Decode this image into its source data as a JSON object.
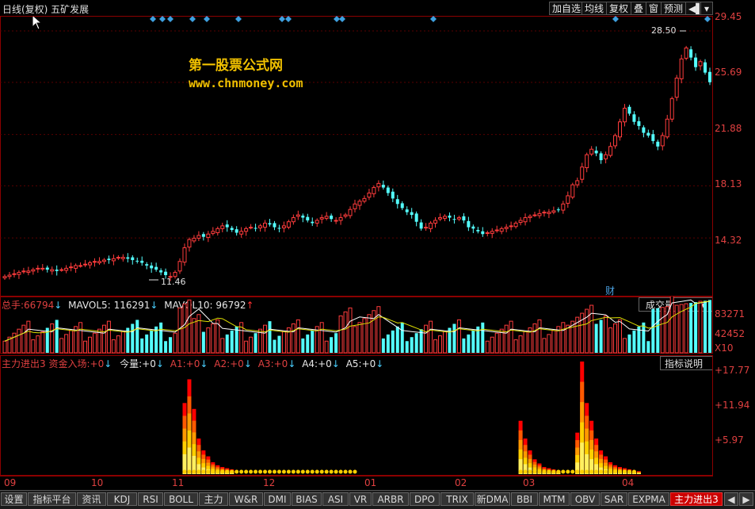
{
  "title": "日线(复权) 五矿发展",
  "toolbar": {
    "add_watch": "加自选",
    "ma_line": "均线",
    "restore": "复权",
    "overlay": "叠",
    "window": "窗",
    "forecast": "预测"
  },
  "watermark": {
    "line1": "第一股票公式网",
    "line2": "www.chnmoney.com"
  },
  "price_panel": {
    "y_ticks": [
      "29.45",
      "25.69",
      "21.88",
      "18.13",
      "14.32"
    ],
    "high_label": "28.50",
    "low_label": "11.46",
    "finance_marker": "财"
  },
  "volume_panel": {
    "legend": {
      "total_label": "总手:",
      "total_value": "66794",
      "mavol5_label": "MAVOL5:",
      "mavol5_value": "116291",
      "mavol10_label": "MAVOL10:",
      "mavol10_value": "96792"
    },
    "selector": "成交量",
    "y_ticks": [
      "83271",
      "42452"
    ],
    "unit": "X10"
  },
  "indicator_panel": {
    "legend": {
      "name": "主力进出3",
      "item1_label": "资金入场:",
      "item1_value": "+0",
      "item2_label": "今量:",
      "item2_value": "+0",
      "a1_label": "A1:",
      "a1_value": "+0",
      "a2_label": "A2:",
      "a2_value": "+0",
      "a3_label": "A3:",
      "a3_value": "+0",
      "a4_label": "A4:",
      "a4_value": "+0",
      "a5_label": "A5:",
      "a5_value": "+0"
    },
    "help_button": "指标说明",
    "y_ticks": [
      "+17.77",
      "+11.94",
      "+5.97"
    ]
  },
  "date_axis": [
    "09",
    "10",
    "11",
    "12",
    "01",
    "02",
    "03",
    "04"
  ],
  "tabs": [
    "设置",
    "指标平台",
    "资讯",
    "KDJ",
    "RSI",
    "BOLL",
    "主力",
    "W&R",
    "DMI",
    "BIAS",
    "ASI",
    "VR",
    "ARBR",
    "DPO",
    "TRIX",
    "新DMA",
    "BBI",
    "MTM",
    "OBV",
    "SAR",
    "EXPMA",
    "主力进出3"
  ],
  "chart_data": {
    "type": "candlestick",
    "price_range": [
      10.5,
      30.2
    ],
    "close_series": [
      11.5,
      11.6,
      11.7,
      11.8,
      11.9,
      11.9,
      12.0,
      12.1,
      12.1,
      12.0,
      12.0,
      11.9,
      12.0,
      12.1,
      12.2,
      12.3,
      12.3,
      12.4,
      12.5,
      12.6,
      12.6,
      12.7,
      12.7,
      12.8,
      12.9,
      12.9,
      12.8,
      12.7,
      12.6,
      12.5,
      12.3,
      12.1,
      12.0,
      11.8,
      11.6,
      11.5,
      11.8,
      12.6,
      13.6,
      14.2,
      14.3,
      14.5,
      14.4,
      14.6,
      14.8,
      15.0,
      15.2,
      15.1,
      14.9,
      14.7,
      14.8,
      15.0,
      15.1,
      15.0,
      15.2,
      15.4,
      15.3,
      15.1,
      15.0,
      15.2,
      15.5,
      15.8,
      16.0,
      15.8,
      15.6,
      15.4,
      15.6,
      15.8,
      15.9,
      15.7,
      15.6,
      15.8,
      16.0,
      16.4,
      16.8,
      17.0,
      17.2,
      17.6,
      18.0,
      18.3,
      18.0,
      17.6,
      17.2,
      16.8,
      16.5,
      16.2,
      16.0,
      15.5,
      15.0,
      15.1,
      15.4,
      15.6,
      15.8,
      15.9,
      15.8,
      15.7,
      15.8,
      15.6,
      15.1,
      15.0,
      14.8,
      14.6,
      14.7,
      14.8,
      14.9,
      15.0,
      15.1,
      15.2,
      15.4,
      15.6,
      15.8,
      15.9,
      16.0,
      16.1,
      16.2,
      16.2,
      16.3,
      16.4,
      16.8,
      17.4,
      18.2,
      18.5,
      19.5,
      20.4,
      20.8,
      20.5,
      20.0,
      20.4,
      21.0,
      21.8,
      22.8,
      23.8,
      23.4,
      22.8,
      22.5,
      22.0,
      21.8,
      21.4,
      21.0,
      21.8,
      23.0,
      24.5,
      26.0,
      27.4,
      28.2,
      27.5,
      26.8,
      27.2,
      26.4,
      25.7
    ],
    "volume_range": [
      0,
      100000
    ],
    "indicator_range": [
      0,
      19
    ]
  }
}
